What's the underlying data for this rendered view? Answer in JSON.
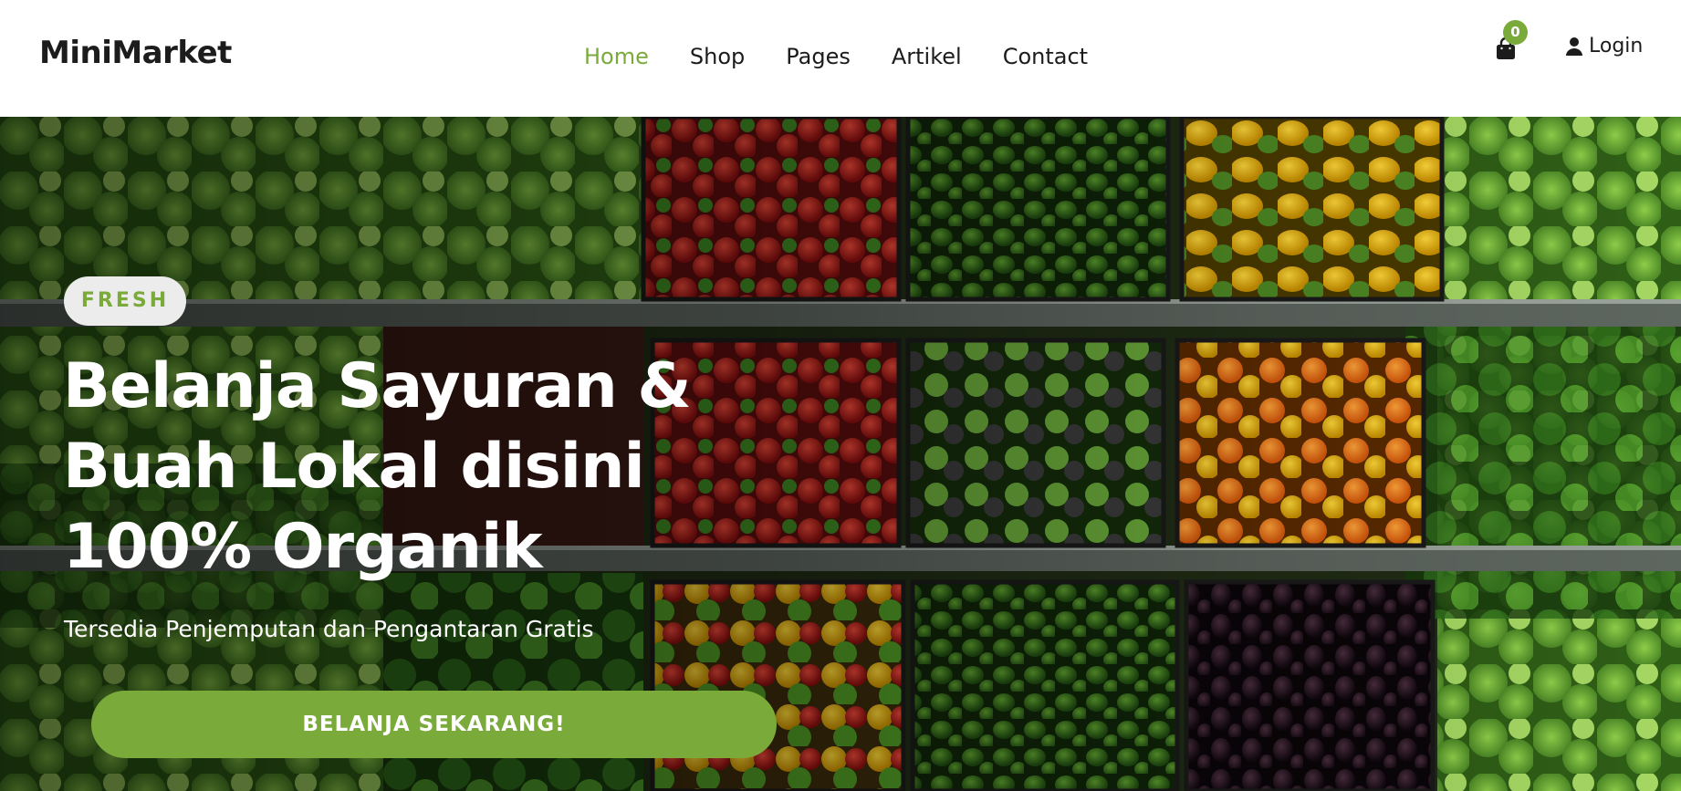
{
  "header": {
    "brand": "MiniMarket",
    "nav": [
      "Home",
      "Shop",
      "Pages",
      "Artikel",
      "Contact"
    ],
    "active_nav": "Home",
    "cart_count": "0",
    "login_label": "Login",
    "icons": {
      "cart": "shopping-bag-icon",
      "login": "user-icon"
    }
  },
  "hero": {
    "badge": "FRESH",
    "title_lines": [
      "Belanja Sayuran &",
      "Buah Lokal disini",
      "100% Organik"
    ],
    "subtitle": "Tersedia Penjemputan dan Pengantaran Gratis",
    "cta_label": "BELANJA SEKARANG!"
  },
  "colors": {
    "accent": "#7aab3a",
    "text_dark": "#1c1c1c",
    "badge_bg": "#ececec"
  }
}
